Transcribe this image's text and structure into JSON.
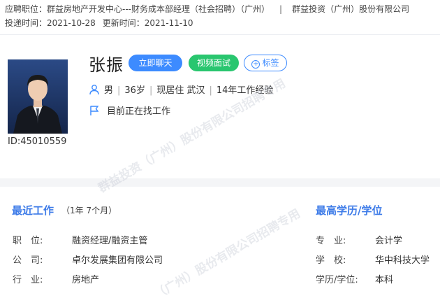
{
  "header": {
    "position_label": "应聘职位：",
    "position_value": "群益房地产开发中心---财务成本部经理（社会招聘）（广州）",
    "company": "群益投资（广州）股份有限公司",
    "apply_label": "投递时间：",
    "apply_time": "2021-10-28",
    "update_label": "更新时间：",
    "update_time": "2021-11-10"
  },
  "candidate": {
    "name": "张振",
    "id_text": "ID:45010559",
    "gender": "男",
    "age": "36岁",
    "residence": "现居住 武汉",
    "experience": "14年工作经验",
    "status": "目前正在找工作"
  },
  "actions": {
    "chat": "立即聊天",
    "video": "视频面试",
    "tag": "标签"
  },
  "recent_work": {
    "title": "最近工作",
    "duration": "（1年 7个月）",
    "rows": [
      {
        "label": "职　位:",
        "value": "融资经理/融资主管"
      },
      {
        "label": "公　司:",
        "value": "卓尔发展集团有限公司"
      },
      {
        "label": "行　业:",
        "value": "房地产"
      }
    ]
  },
  "education": {
    "title": "最高学历/学位",
    "rows": [
      {
        "label": "专　业:",
        "value": "会计学"
      },
      {
        "label": "学　校:",
        "value": "华中科技大学"
      },
      {
        "label": "学历/学位:",
        "value": "本科"
      }
    ]
  },
  "watermark": {
    "line_a": "群益投资（广州）股份有限公司招聘专用",
    "line_b": "（广州）股份有限公司招聘专用"
  },
  "colors": {
    "accent_blue": "#3d8bff",
    "accent_green": "#29c66f",
    "section_title": "#3d7be8"
  }
}
